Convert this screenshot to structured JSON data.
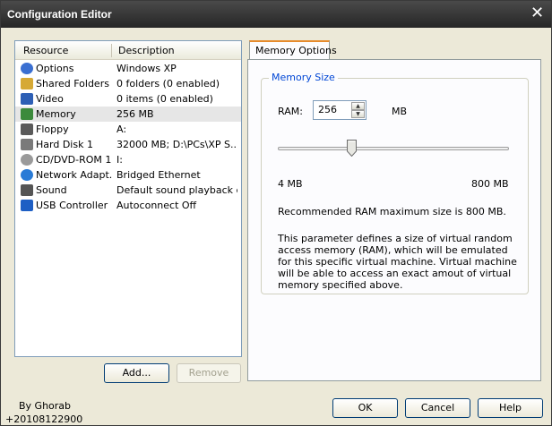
{
  "window": {
    "title": "Configuration Editor"
  },
  "list": {
    "headers": {
      "resource": "Resource",
      "description": "Description"
    },
    "rows": [
      {
        "name": "Options",
        "desc": "Windows XP",
        "icon": "options-icon",
        "color": "#3a6fd1",
        "selected": false
      },
      {
        "name": "Shared Folders",
        "desc": "0 folders (0 enabled)",
        "icon": "shared-folders-icon",
        "color": "#d6a935",
        "selected": false
      },
      {
        "name": "Video",
        "desc": "0 items (0 enabled)",
        "icon": "video-monitor-icon",
        "color": "#2d5fb5",
        "selected": false
      },
      {
        "name": "Memory",
        "desc": "256 MB",
        "icon": "memory-chip-icon",
        "color": "#3c8a3c",
        "selected": true
      },
      {
        "name": "Floppy",
        "desc": "A:",
        "icon": "floppy-icon",
        "color": "#5a5a5a",
        "selected": false
      },
      {
        "name": "Hard Disk 1",
        "desc": "32000 MB; D:\\PCs\\XP S...",
        "icon": "hard-disk-icon",
        "color": "#7a7a7a",
        "selected": false
      },
      {
        "name": "CD/DVD-ROM 1",
        "desc": "I:",
        "icon": "cd-dvd-icon",
        "color": "#9a9a9a",
        "selected": false
      },
      {
        "name": "Network Adapt...",
        "desc": "Bridged Ethernet",
        "icon": "network-globe-icon",
        "color": "#2a7bd6",
        "selected": false
      },
      {
        "name": "Sound",
        "desc": "Default sound playback d...",
        "icon": "sound-speaker-icon",
        "color": "#555555",
        "selected": false
      },
      {
        "name": "USB Controller",
        "desc": "Autoconnect Off",
        "icon": "usb-icon",
        "color": "#1e5fc4",
        "selected": false
      }
    ],
    "add_label": "Add...",
    "remove_label": "Remove"
  },
  "tab": {
    "label": "Memory Options"
  },
  "memory": {
    "group_title": "Memory Size",
    "ram_label": "RAM:",
    "ram_value": "256",
    "unit_label": "MB",
    "slider": {
      "min": 4,
      "max": 800,
      "value": 256
    },
    "min_label": "4 MB",
    "max_label": "800 MB",
    "recommended": "Recommended RAM maximum size is 800 MB.",
    "description": "This parameter defines a size of virtual random access memory (RAM), which will be emulated for this specific virtual machine. Virtual machine will be able to access an exact amout of virtual memory specified above."
  },
  "footer": {
    "note_line1": "By Ghorab",
    "note_line2": "+20108122900",
    "ok_label": "OK",
    "cancel_label": "Cancel",
    "help_label": "Help"
  }
}
